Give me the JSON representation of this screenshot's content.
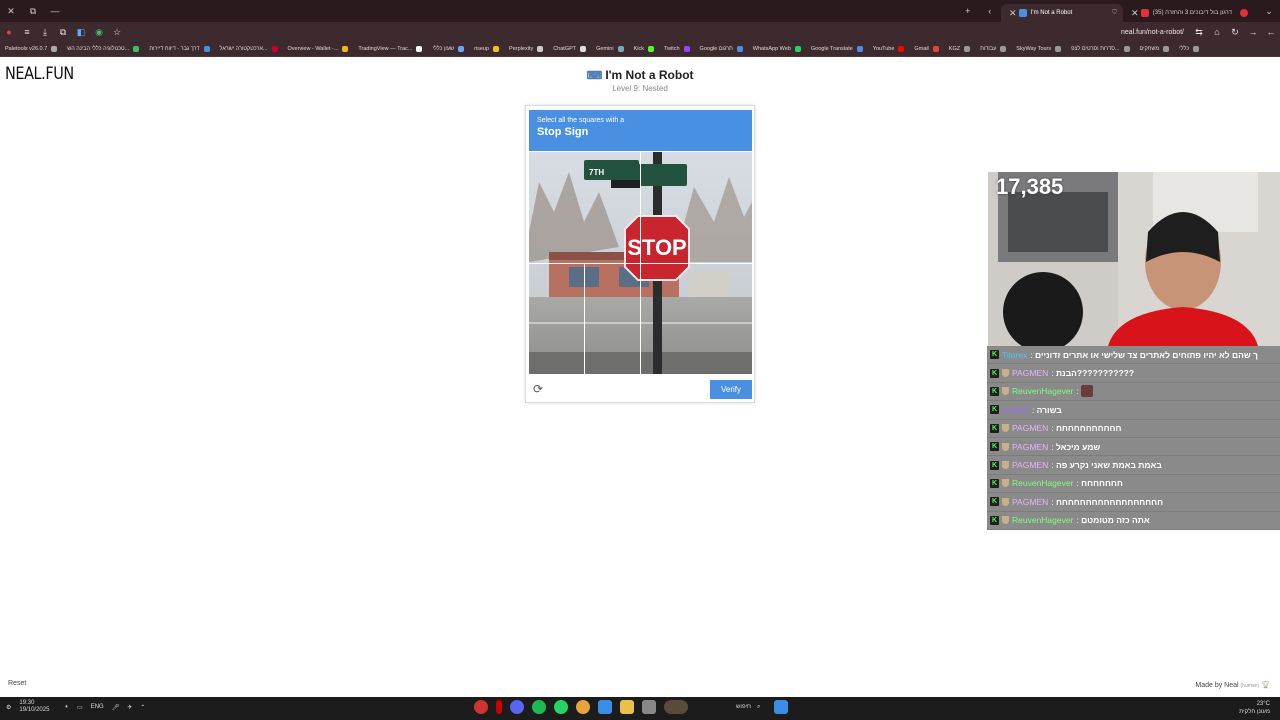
{
  "browser": {
    "tabs": [
      {
        "label": "I'm Not a Robot",
        "color": "#4a90e2",
        "active": true
      },
      {
        "label": "(35) דרגון בול דיבוכים 3 והחזרה",
        "color": "#e0303a",
        "active": false
      }
    ],
    "address": "neal.fun/not-a-robot/",
    "bookmarks": [
      "Paletools v26.0.7",
      "טכנולוגיה כללי הבינה הש...",
      "דרך גבר - דיווח דיירות",
      "ארכטקטורה ישראל...",
      "Overview - Wallet -...",
      "TradingView — Trac...",
      "שעון כללי",
      "riseup",
      "Perplexity",
      "ChatGPT",
      "Gemini",
      "Kick",
      "Twitch",
      "Google תרגום",
      "WhatsApp Web",
      "Google Translate",
      "YouTube",
      "Gmail",
      "KGZ",
      "עבודות",
      "SkyWay Tours",
      "סדרות וסרטים לצפ...",
      "משחקים",
      "כללי"
    ]
  },
  "page": {
    "logo": "NEAL.FUN",
    "title": "I'm Not a Robot",
    "level": "Level 9: Nested"
  },
  "captcha": {
    "instruction_small": "Select all the squares with a",
    "instruction_target": "Stop Sign",
    "sign_text": "STOP",
    "street_sign": "7TH",
    "verify_label": "Verify",
    "refresh_icon": "refresh-icon"
  },
  "stream": {
    "counter": "17,385",
    "chat": [
      {
        "user": "Tilorex",
        "color": "#4fc3f7",
        "message": "ך שהם לא יהיו פתוחים לאתרים צד שלישי או אתרים זדוניים"
      },
      {
        "user": "PAGMEN",
        "color": "#e6b3ff",
        "message": "הבנת???????????"
      },
      {
        "user": "ReuvenHagever",
        "color": "#7dff7d",
        "message": ""
      },
      {
        "user": "onlevi1",
        "color": "#9c6bff",
        "message": "בשורה"
      },
      {
        "user": "PAGMEN",
        "color": "#e6b3ff",
        "message": "חחחחחחחחחחח"
      },
      {
        "user": "PAGMEN",
        "color": "#e6b3ff",
        "message": "שמע מיכאל"
      },
      {
        "user": "PAGMEN",
        "color": "#e6b3ff",
        "message": "באמת באמת שאני נקרע פה"
      },
      {
        "user": "ReuvenHagever",
        "color": "#7dff7d",
        "message": "חחחחחחח"
      },
      {
        "user": "PAGMEN",
        "color": "#e6b3ff",
        "message": "חחחחחחחחחחחחחחחחחח"
      },
      {
        "user": "ReuvenHagever",
        "color": "#7dff7d",
        "message": "אתה כזה מטומטם"
      }
    ]
  },
  "footer": {
    "reset": "Reset",
    "made_by": "Made by Neal",
    "human": "(human)"
  },
  "taskbar": {
    "time": "19:30",
    "date": "19/10/2025",
    "lang": "ENG",
    "search": "חיפוש",
    "weather": "23°C",
    "weather_desc": "מעונן חלקית"
  }
}
